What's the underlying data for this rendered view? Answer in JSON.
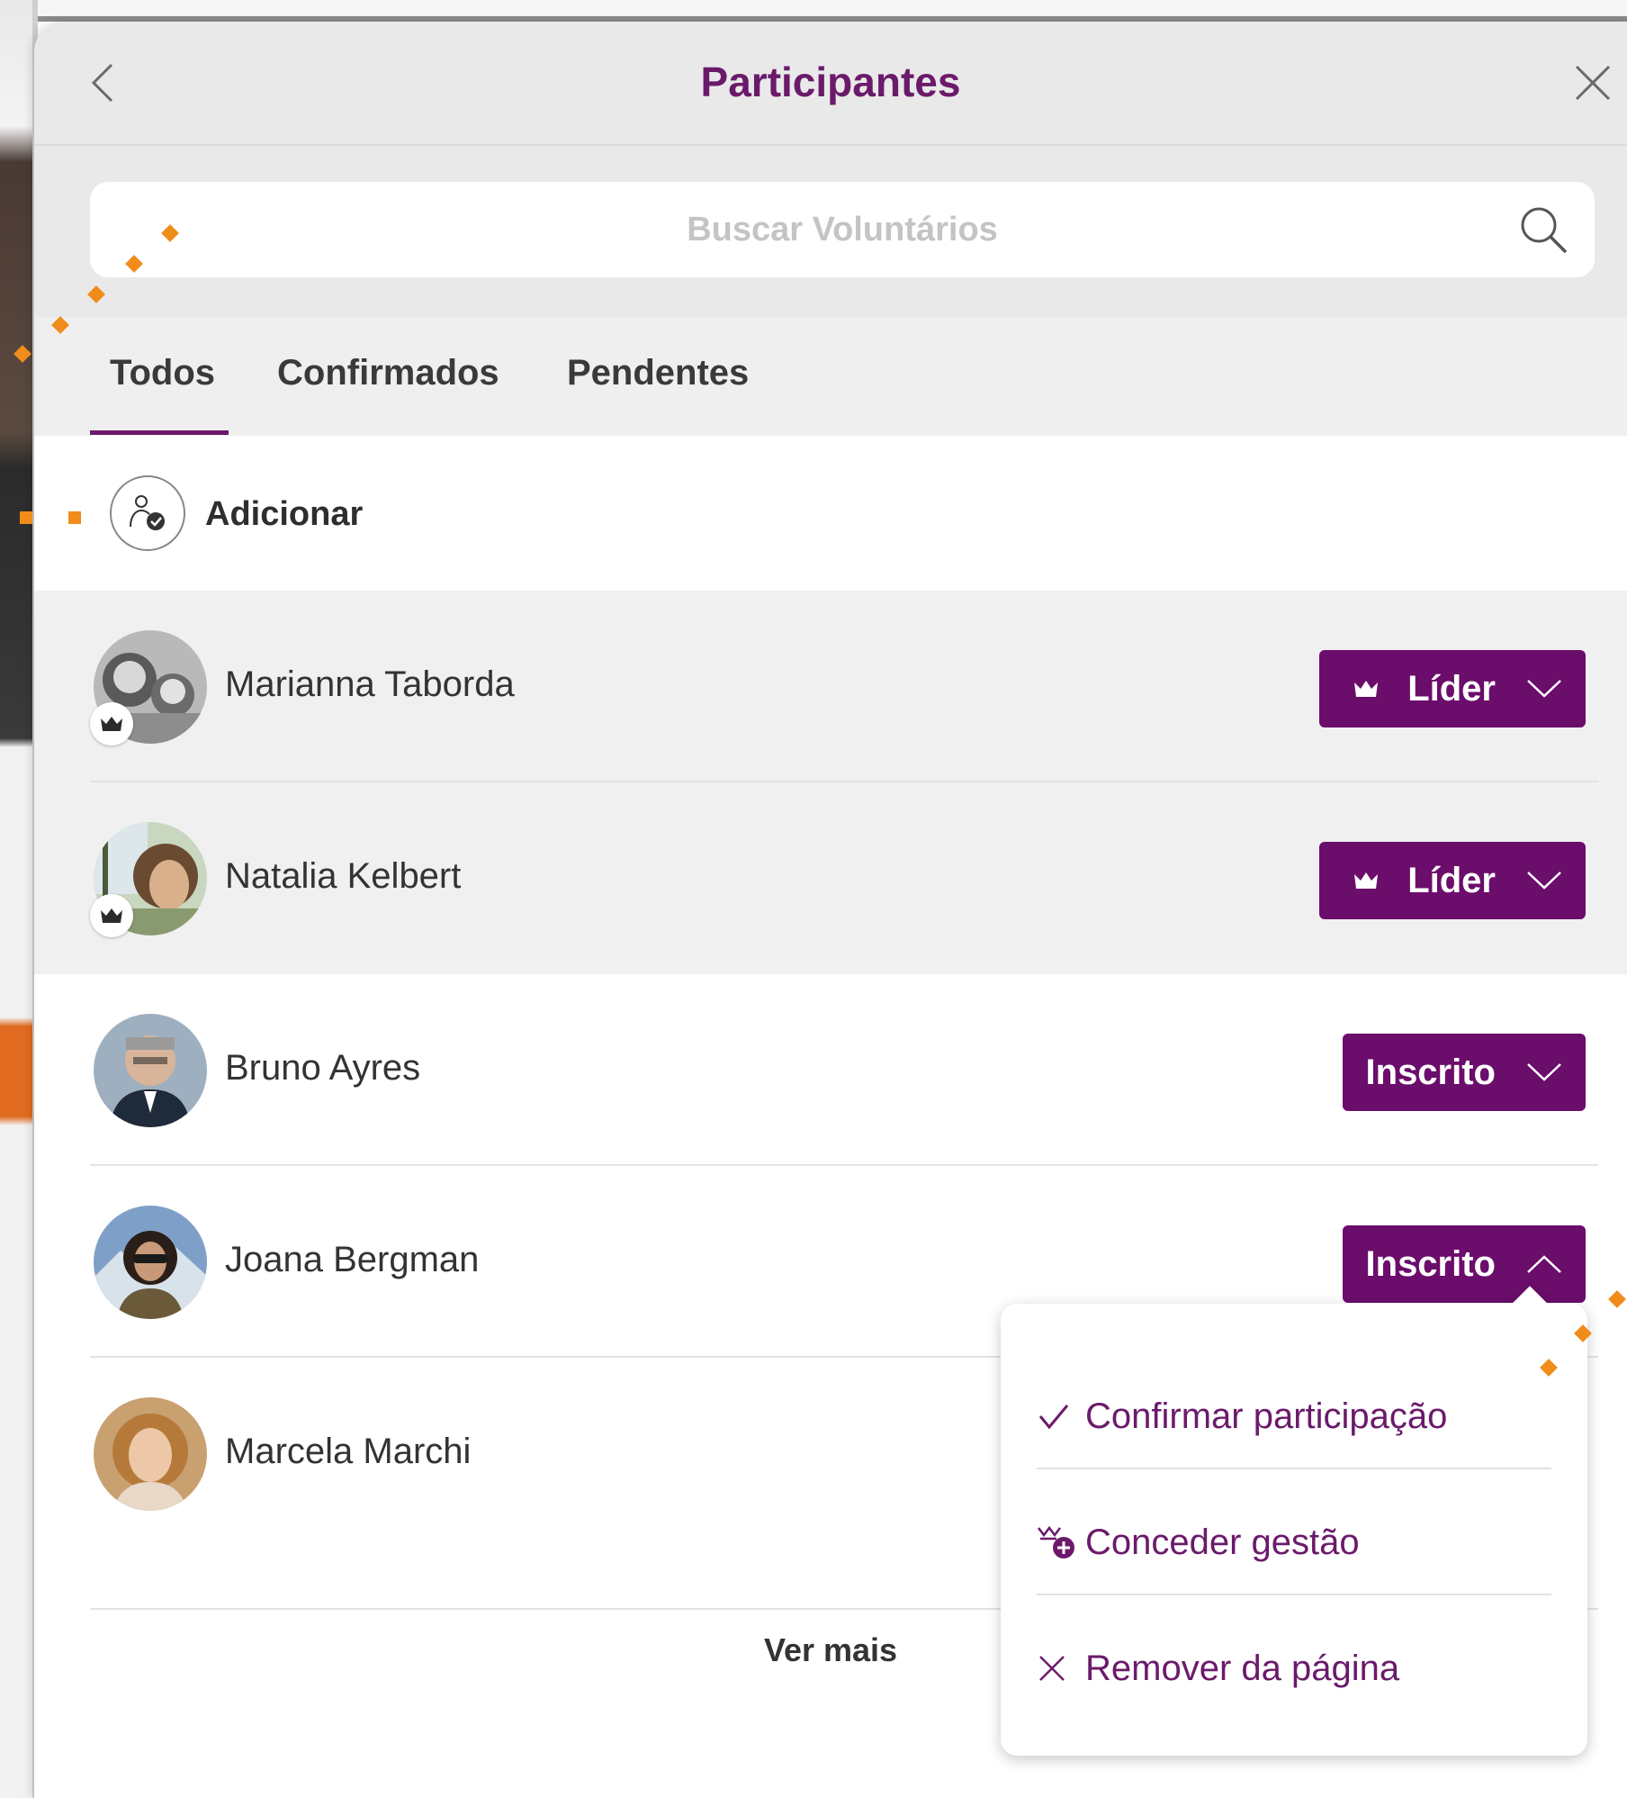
{
  "modal": {
    "title": "Participantes"
  },
  "search": {
    "placeholder": "Buscar Voluntários"
  },
  "tabs": [
    {
      "label": "Todos",
      "active": true
    },
    {
      "label": "Confirmados",
      "active": false
    },
    {
      "label": "Pendentes",
      "active": false
    }
  ],
  "add": {
    "label": "Adicionar"
  },
  "members": [
    {
      "name": "Marianna Taborda",
      "role": "Líder",
      "leader": true
    },
    {
      "name": "Natalia Kelbert",
      "role": "Líder",
      "leader": true
    },
    {
      "name": "Bruno Ayres",
      "role": "Inscrito",
      "leader": false
    },
    {
      "name": "Joana Bergman",
      "role": "Inscrito",
      "leader": false,
      "menu_open": true
    },
    {
      "name": "Marcela Marchi",
      "role": "",
      "leader": false
    }
  ],
  "more_label": "Ver mais",
  "dropdown": {
    "items": [
      {
        "label": "Confirmar participação",
        "icon": "check-icon"
      },
      {
        "label": "Conceder gestão",
        "icon": "crown-plus-icon"
      },
      {
        "label": "Remover da página",
        "icon": "x-icon"
      }
    ]
  },
  "colors": {
    "brand_purple": "#6b0d6b",
    "title_purple": "#6b1a6b",
    "annotation_orange": "#f08c1a"
  }
}
